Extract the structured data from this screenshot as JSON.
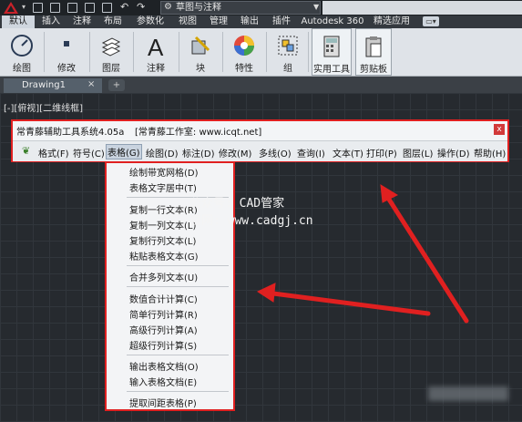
{
  "quick_access": {
    "workspace": "草图与注释",
    "icons": [
      "new-icon",
      "open-icon",
      "save-icon",
      "saveas-icon",
      "print-icon",
      "undo-icon",
      "redo-icon"
    ]
  },
  "ribbon_tabs": [
    "默认",
    "插入",
    "注释",
    "布局",
    "参数化",
    "视图",
    "管理",
    "输出",
    "插件",
    "Autodesk 360",
    "精选应用"
  ],
  "ribbon_buttons": [
    "绘图",
    "修改",
    "图层",
    "注释",
    "块",
    "特性",
    "组",
    "实用工具",
    "剪贴板"
  ],
  "doc_tab": {
    "title": "Drawing1",
    "close": "×",
    "new": "+"
  },
  "viewport_label": "[-][俯视][二维线框]",
  "tool_window": {
    "title": "常青藤辅助工具系统4.05a",
    "site": "[常青藤工作室: www.icqt.net]",
    "close": "x",
    "menus": [
      "格式(F)",
      "符号(C)",
      "表格(G)",
      "绘图(D)",
      "标注(D)",
      "修改(M)",
      "多线(O)",
      "查询(I)",
      "文本(T)",
      "打印(P)",
      "图层(L)",
      "操作(D)",
      "帮助(H)"
    ]
  },
  "dropdown": {
    "groups": [
      [
        "绘制带宽网格(D)",
        "表格文字居中(T)"
      ],
      [
        "复制一行文本(R)",
        "复制一列文本(L)",
        "复制行列文本(L)",
        "粘贴表格文本(G)"
      ],
      [
        "合并多列文本(U)"
      ],
      [
        "数值合计计算(C)",
        "简单行列计算(R)",
        "高级行列计算(A)",
        "超级行列计算(S)"
      ],
      [
        "输出表格文档(O)",
        "输入表格文档(E)"
      ],
      [
        "提取间距表格(P)"
      ]
    ]
  },
  "watermark": {
    "line1": "公众号: CAD管家",
    "line2": "官网: www.cadgj.cn"
  },
  "colors": {
    "annotation": "#e02020",
    "active_tab": "#cfd6de"
  }
}
